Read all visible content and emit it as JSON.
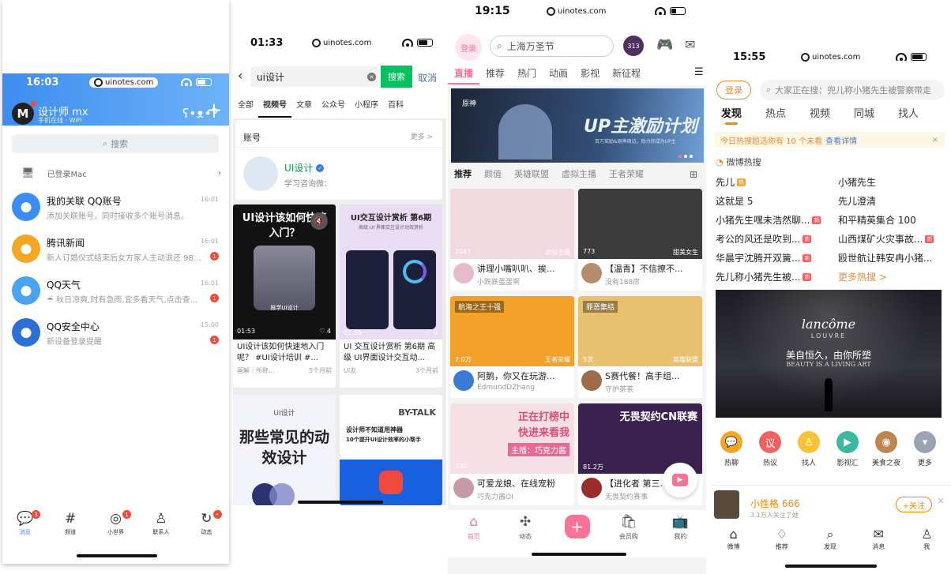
{
  "watermark": "uinotes.com",
  "qq": {
    "time": "16:03",
    "user": {
      "avatar_letter": "M",
      "name": "设计师 mx",
      "status": "手机在线 · WiFi"
    },
    "search_placeholder": "搜索",
    "logged_in_mac": "已登录Mac",
    "messages": [
      {
        "title": "我的关联 QQ账号",
        "snippet": "添加关联账号，同时接收多个账号消息。",
        "time": "16:01",
        "badge": "",
        "color": "#3b8cf5",
        "icon": "qq-link-icon"
      },
      {
        "title": "腾讯新闻",
        "snippet": "新人订婚仪式结束后女方家人主动退还 98...",
        "time": "16:01",
        "badge": "1",
        "color": "#f5a623",
        "icon": "news-bell-icon"
      },
      {
        "title": "QQ天气",
        "snippet": "☔ 秋日凉爽,时有急雨,宜多看天气,点击查...",
        "time": "16:01",
        "badge": "1",
        "color": "#4aa3f0",
        "icon": "weather-cloud-icon"
      },
      {
        "title": "QQ安全中心",
        "snippet": "新设备登录提醒",
        "time": "15:00",
        "badge": "1",
        "color": "#2c6fd6",
        "icon": "shield-icon"
      }
    ],
    "tabs": [
      {
        "label": "消息",
        "glyph": "💬",
        "badge": "3"
      },
      {
        "label": "频道",
        "glyph": "#",
        "badge": ""
      },
      {
        "label": "小世界",
        "glyph": "◎",
        "badge": "1"
      },
      {
        "label": "联系人",
        "glyph": "♙",
        "badge": ""
      },
      {
        "label": "动态",
        "glyph": "↻",
        "badge": "•"
      }
    ]
  },
  "wechat": {
    "time": "01:33",
    "query": "ui设计",
    "search_button": "搜索",
    "cancel": "取消",
    "tabs": [
      "全部",
      "视频号",
      "文章",
      "公众号",
      "小程序",
      "百科"
    ],
    "account_section": {
      "title": "账号",
      "more": "更多 >",
      "name": "UI设计",
      "desc": "学习咨询微："
    },
    "videos": [
      {
        "title": "UI设计该如何快速入门？",
        "caption": "UI设计该如何快速地入门呢？ #UI设计培训 #...",
        "author": "画解｜所称...",
        "age": "5个月前",
        "duration": "01:53",
        "likes": "4",
        "thumb_caption": "推学UI设计"
      },
      {
        "title": "UI交互设计赏析 第6期",
        "subtitle": "高级 UI 界面交互设计动效赏析",
        "caption": "UI 交互设计赏析 第6期 高级 UI界面设计交互动...",
        "author": "UI友",
        "age": "3个月前",
        "duration": "01:55",
        "likes": "0"
      },
      {
        "title": "那些常见的动效设计",
        "tag": "UI设计"
      },
      {
        "title": "BY-TALK",
        "line1": "设计师不知道用神器",
        "line2": "10个提升UI设计效率的小帮手"
      }
    ]
  },
  "bilibili": {
    "time": "19:15",
    "login": "登录",
    "search": "上海万圣节",
    "channels": [
      "直播",
      "推荐",
      "热门",
      "动画",
      "影视",
      "新征程"
    ],
    "banner": {
      "title": "UP主激励计划",
      "top": "原神",
      "subline": "百万奖励&原神周边，助力你成为UP主"
    },
    "subtabs": [
      "推荐",
      "颜值",
      "英雄联盟",
      "虚拟主播",
      "王者荣耀"
    ],
    "cards": [
      {
        "title": "讲理小嘴叭叭、挨...",
        "user": "小跌跌蛋蛋啊",
        "count": "2047",
        "tag": "虚拟主播",
        "bg": "#f1d9e0",
        "avatar": "#e8b9c9"
      },
      {
        "title": "【温青】不信撩不...",
        "user": "没有188房",
        "count": "773",
        "tag": "甜美女生",
        "bg": "#3b3b3b",
        "avatar": "#b38d6e"
      },
      {
        "title": "阿鹅，你又在玩游...",
        "user": "EdmundDZhang",
        "count": "7.0万",
        "tag": "王者荣耀",
        "bg": "#f2a12b",
        "avatar": "#3b7bd8",
        "badge": "航海之王十强"
      },
      {
        "title": "S赛代餐！高手组...",
        "user": "守护茶茶",
        "count": "5次",
        "tag": "英雄联盟",
        "bg": "#e8c070",
        "avatar": "#9d6d4b",
        "badge": "罪恶集结"
      },
      {
        "title": "可爱龙娘、在线宠粉",
        "user": "巧克力酱OI",
        "count": "730",
        "tag": "",
        "bg": "#f7dfe6",
        "avatar": "#c79aa8",
        "overlay1": "正在打榜中",
        "overlay2": "快进来看我",
        "overlay3": "主播：巧克力酱"
      },
      {
        "title": "【进化者 第三...",
        "user": "无畏契约赛事",
        "count": "81.2万",
        "tag": "",
        "bg": "#3a2150",
        "avatar": "#9b2c2c",
        "overlay1": "无畏契约CN联赛"
      }
    ],
    "tabs": [
      {
        "label": "首页",
        "glyph": "⌂"
      },
      {
        "label": "动态",
        "glyph": "✣"
      },
      {
        "label": "",
        "glyph": "+"
      },
      {
        "label": "会员购",
        "glyph": "🛍"
      },
      {
        "label": "我的",
        "glyph": "📺"
      }
    ]
  },
  "weibo": {
    "time": "15:55",
    "login": "登录",
    "search": "大家正在搜：兜儿称小猪先生被警察带走",
    "tabs": [
      "发现",
      "热点",
      "视频",
      "同城",
      "找人"
    ],
    "notice": "今日热搜题选你有 10 个未看",
    "notice_link": "查看详情",
    "hot_title": "微博热搜",
    "hot_left": [
      {
        "text": "先儿",
        "mark": "热",
        "color": "#f5a623"
      },
      {
        "text": "这就是 5",
        "mark": "",
        "color": ""
      },
      {
        "text": "小猪先生嘿未浩然聊...",
        "mark": "新",
        "color": "#ff5a5a"
      },
      {
        "text": "考公的风还是吹到...",
        "mark": "新",
        "color": "#ff5a5a"
      },
      {
        "text": "华晨宇沈腾开双簧...",
        "mark": "新",
        "color": "#ff5a5a"
      },
      {
        "text": "先儿称小猪先生被...",
        "mark": "新",
        "color": "#ff5a5a"
      }
    ],
    "hot_right": [
      {
        "text": "小猪先生",
        "mark": "",
        "color": ""
      },
      {
        "text": "先儿澄清",
        "mark": "",
        "color": ""
      },
      {
        "text": "和平精英集合 100",
        "mark": "",
        "color": ""
      },
      {
        "text": "山西煤矿火灾事故...",
        "mark": "新",
        "color": "#ff5a5a"
      },
      {
        "text": "殴世航让韩安冉小猪...",
        "mark": "",
        "color": ""
      },
      {
        "text": "更多热搜 >",
        "mark": "",
        "color": "",
        "link": true
      }
    ],
    "ad": {
      "brand": "lancôme",
      "brand2": "LOUVRE",
      "line1": "美自恒久，由你所塑",
      "line2": "BEAUTY IS A LIVING ART"
    },
    "quick": [
      {
        "label": "热聊",
        "color": "#f5a623",
        "glyph": "💬"
      },
      {
        "label": "热议",
        "color": "#f06262",
        "glyph": "议"
      },
      {
        "label": "找人",
        "color": "#f5c23a",
        "glyph": "♙"
      },
      {
        "label": "影视汇",
        "color": "#3ab8a0",
        "glyph": "▶"
      },
      {
        "label": "美食之夜",
        "color": "#c0844e",
        "glyph": "◉"
      },
      {
        "label": "更多",
        "color": "#9aa3b3",
        "glyph": "▾"
      }
    ],
    "promo": {
      "name": "小性格 666",
      "fans": "3.1万人关注了她",
      "follow": "+关注"
    },
    "bottom_tabs": [
      {
        "label": "微博",
        "glyph": "⌂"
      },
      {
        "label": "推荐",
        "glyph": "♢"
      },
      {
        "label": "发现",
        "glyph": "⌕"
      },
      {
        "label": "消息",
        "glyph": "✉"
      },
      {
        "label": "我",
        "glyph": "♙"
      }
    ]
  }
}
